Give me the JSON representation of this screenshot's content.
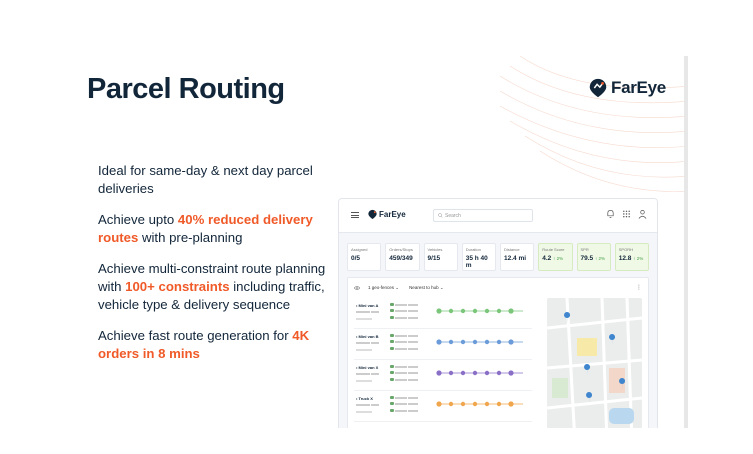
{
  "slide": {
    "title": "Parcel Routing",
    "logo_text": "FarEye",
    "bullets": [
      {
        "parts": [
          {
            "t": "Ideal for same-day & next day parcel deliveries",
            "hl": false
          }
        ]
      },
      {
        "parts": [
          {
            "t": "Achieve upto ",
            "hl": false
          },
          {
            "t": "40% reduced delivery routes",
            "hl": true
          },
          {
            "t": " with pre-planning",
            "hl": false
          }
        ]
      },
      {
        "parts": [
          {
            "t": "Achieve multi-constraint route planning with ",
            "hl": false
          },
          {
            "t": "100+ constraints",
            "hl": true
          },
          {
            "t": " including traffic, vehicle type & delivery sequence",
            "hl": false
          }
        ]
      },
      {
        "parts": [
          {
            "t": "Achieve fast route generation for ",
            "hl": false
          },
          {
            "t": "4K orders in 8 mins",
            "hl": true
          }
        ]
      }
    ],
    "colors": {
      "accent": "#f05a28",
      "text": "#12263a",
      "stat_green": "#f0f9e6"
    }
  },
  "app": {
    "logo_text": "FarEye",
    "search_placeholder": "Search",
    "stats": [
      {
        "label": "Assigned",
        "value": "0/5",
        "trend": "",
        "green": false
      },
      {
        "label": "Orders/Stops",
        "value": "459/349",
        "trend": "",
        "green": false
      },
      {
        "label": "Vehicles",
        "value": "9/15",
        "trend": "",
        "green": false
      },
      {
        "label": "Duration",
        "value": "35 h 40 m",
        "trend": "",
        "green": false
      },
      {
        "label": "Distance",
        "value": "12.4 mi",
        "trend": "",
        "green": false
      },
      {
        "label": "Route Score",
        "value": "4.2",
        "trend": "↑ 2%",
        "green": true
      },
      {
        "label": "SPR",
        "value": "79.5",
        "trend": "↑ 2%",
        "green": true
      },
      {
        "label": "SPORH",
        "value": "12.8",
        "trend": "↑ 2%",
        "green": true
      }
    ],
    "filters": {
      "geofences": "1 geo-fences",
      "sort": "Nearest to hub"
    },
    "routes": [
      {
        "name": "Mini van A",
        "chain_color": "#7bc67b"
      },
      {
        "name": "Mini van B",
        "chain_color": "#6b9bd8"
      },
      {
        "name": "Mini van X",
        "chain_color": "#8a6fc7"
      },
      {
        "name": "Truck X",
        "chain_color": "#f0a64d"
      }
    ]
  }
}
